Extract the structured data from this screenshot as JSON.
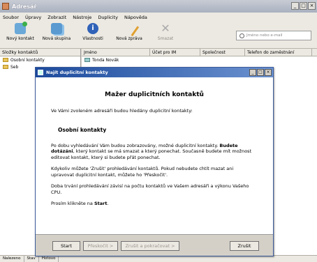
{
  "window": {
    "title": "Adresář"
  },
  "menu": [
    "Soubor",
    "Úpravy",
    "Zobrazit",
    "Nástroje",
    "Duplicity",
    "Nápověda"
  ],
  "toolbar": {
    "items": [
      {
        "label": "Nový kontakt",
        "icon": "new-contact-icon"
      },
      {
        "label": "Nová skupina",
        "icon": "new-group-icon"
      },
      {
        "label": "Vlastnosti",
        "icon": "properties-icon"
      },
      {
        "label": "Nová zpráva",
        "icon": "new-message-icon"
      },
      {
        "label": "Smazat",
        "icon": "delete-icon",
        "disabled": true
      }
    ],
    "search_placeholder": "Jméno nebo e-mail"
  },
  "sidebar": {
    "header": "Složky kontaktů",
    "items": [
      "Osobní kontakty",
      "Seb"
    ]
  },
  "list": {
    "columns": [
      "Jméno",
      "Účet pro IM",
      "Společnost",
      "Telefon do zaměstnání"
    ],
    "rows": [
      "Tonda Novák"
    ]
  },
  "status": {
    "tabs": [
      "Nalezeno",
      "Stav",
      "Hotovo"
    ]
  },
  "dialog": {
    "title": "Najít duplicitní kontakty",
    "heading": "Mažer duplicitních kontaktů",
    "intro": "Ve Vámi zvoleném adresáři budou hledány duplicitní kontakty:",
    "contact": "Osobní kontakty",
    "para1_pre": "Po dobu vyhledávání Vám budou zobrazovány, možné duplicitní kontakty.",
    "para1_bold": "Budete dotázáni",
    "para1_post": ", který kontakt se má smazat a který ponechat. Současně budete mít možnost editovat kontakt, který si budete přát ponechat.",
    "para2": "Kdykoliv můžete 'Zrušit' prohledávání kontaktů. Pokud nebudete chtít mazat ani upravovat duplicitní kontakt, můžete ho 'Přeskočit'.",
    "para3": "Doba trvání prohledávání závisí na počtu kontaktů ve Vašem adresáři a výkonu Vašeho CPU.",
    "para4_pre": "Prosím klikněte na ",
    "para4_bold": "Start",
    "para4_post": ".",
    "buttons": {
      "start": "Start",
      "next": "Přeskočit >",
      "skip": "Zrušit a pokračovat >",
      "cancel": "Zrušit"
    }
  }
}
